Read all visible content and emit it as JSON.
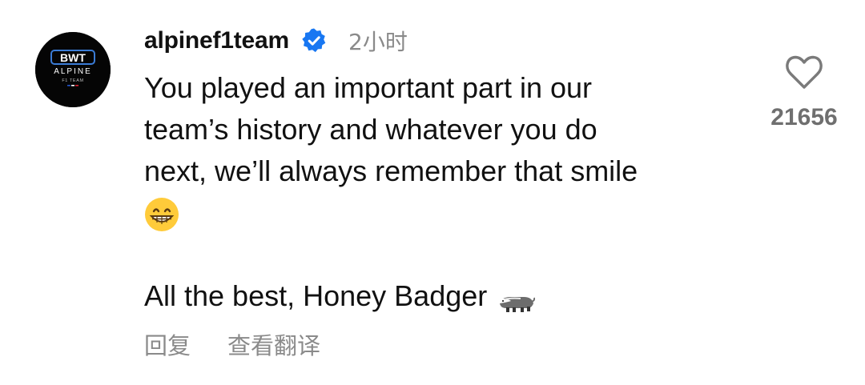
{
  "comment": {
    "avatar": {
      "brand_top": "BWT",
      "brand_mid": "ALPINE",
      "brand_bottom": "F1 TEAM"
    },
    "username": "alpinef1team",
    "verified_icon": "verified-check-icon",
    "time": "2小时",
    "body_lines": [
      "You played an important part in our",
      "team’s history and whatever you do",
      "next, we’ll always remember that smile"
    ],
    "emoji_1": "grinning-face-icon",
    "closing_text": "All the best, Honey Badger",
    "emoji_2": "badger-icon",
    "actions": {
      "reply_label": "回复",
      "translate_label": "查看翻译"
    },
    "like": {
      "icon": "heart-outline-icon",
      "count": "21656"
    },
    "colors": {
      "verified": "#1877f2",
      "secondary_text": "#8a8a8a",
      "avatar_bg": "#050505"
    }
  }
}
